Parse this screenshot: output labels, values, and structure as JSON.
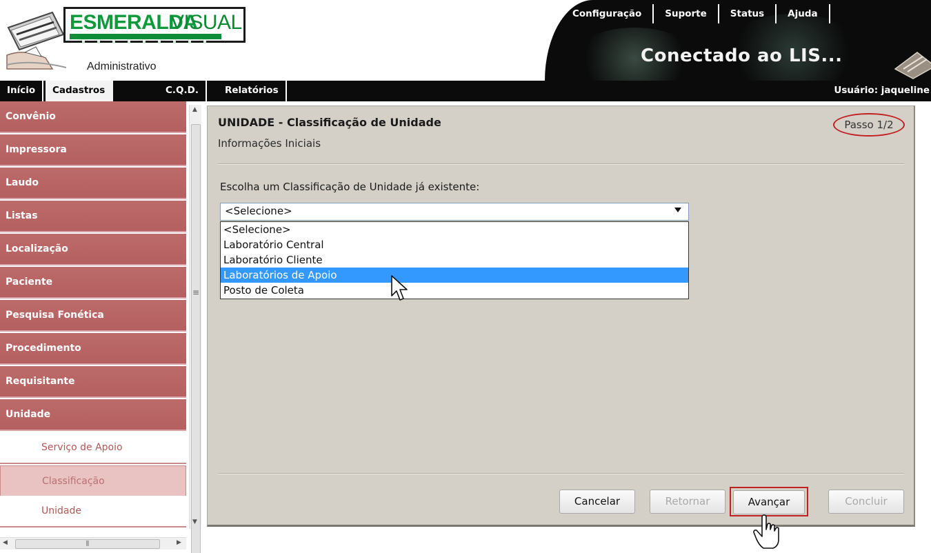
{
  "header": {
    "logo_word_1": "ESMERALDA",
    "logo_word_2": "VISUAL",
    "logo_subtitle": "Administrativo",
    "top_nav": [
      {
        "label": "Configuração"
      },
      {
        "label": "Suporte"
      },
      {
        "label": "Status"
      },
      {
        "label": "Ajuda"
      }
    ],
    "connection_status": "Conectado ao LIS..."
  },
  "navbar": {
    "items": [
      {
        "label": "Início"
      },
      {
        "label": "Cadastros"
      },
      {
        "label": "C.Q.D."
      },
      {
        "label": "Relatórios"
      }
    ],
    "active": "Cadastros",
    "user": "Usuário: jaqueline"
  },
  "sidebar": {
    "items": [
      {
        "label": "Convênio"
      },
      {
        "label": "Impressora"
      },
      {
        "label": "Laudo"
      },
      {
        "label": "Listas"
      },
      {
        "label": "Localização"
      },
      {
        "label": "Paciente"
      },
      {
        "label": "Pesquisa Fonética"
      },
      {
        "label": "Procedimento"
      },
      {
        "label": "Requisitante"
      },
      {
        "label": "Unidade"
      }
    ],
    "sub_items": [
      {
        "label": "Serviço de Apoio"
      },
      {
        "label": "Classificação"
      },
      {
        "label": "Unidade"
      }
    ],
    "selected_sub_item": "Classificação"
  },
  "panel": {
    "title": "UNIDADE - Classificação de Unidade",
    "subtitle": "Informações Iniciais",
    "step": "Passo 1/2",
    "select_label": "Escolha um Classificação de Unidade já existente:",
    "select_value": "<Selecione>",
    "options": [
      {
        "label": "<Selecione>"
      },
      {
        "label": "Laboratório Central"
      },
      {
        "label": "Laboratório Cliente"
      },
      {
        "label": "Laboratórios de Apoio"
      },
      {
        "label": "Posto de Coleta"
      }
    ],
    "highlighted_option": "Laboratórios de Apoio",
    "buttons": {
      "cancel": "Cancelar",
      "back": "Retornar",
      "next": "Avançar",
      "finish": "Concluir"
    }
  },
  "colors": {
    "menu_red": "#b46060",
    "highlight_blue": "#3399ff",
    "panel_gray": "#d4d0c8",
    "annotation_red": "#c02020",
    "logo_green": "#0e9a3a"
  }
}
